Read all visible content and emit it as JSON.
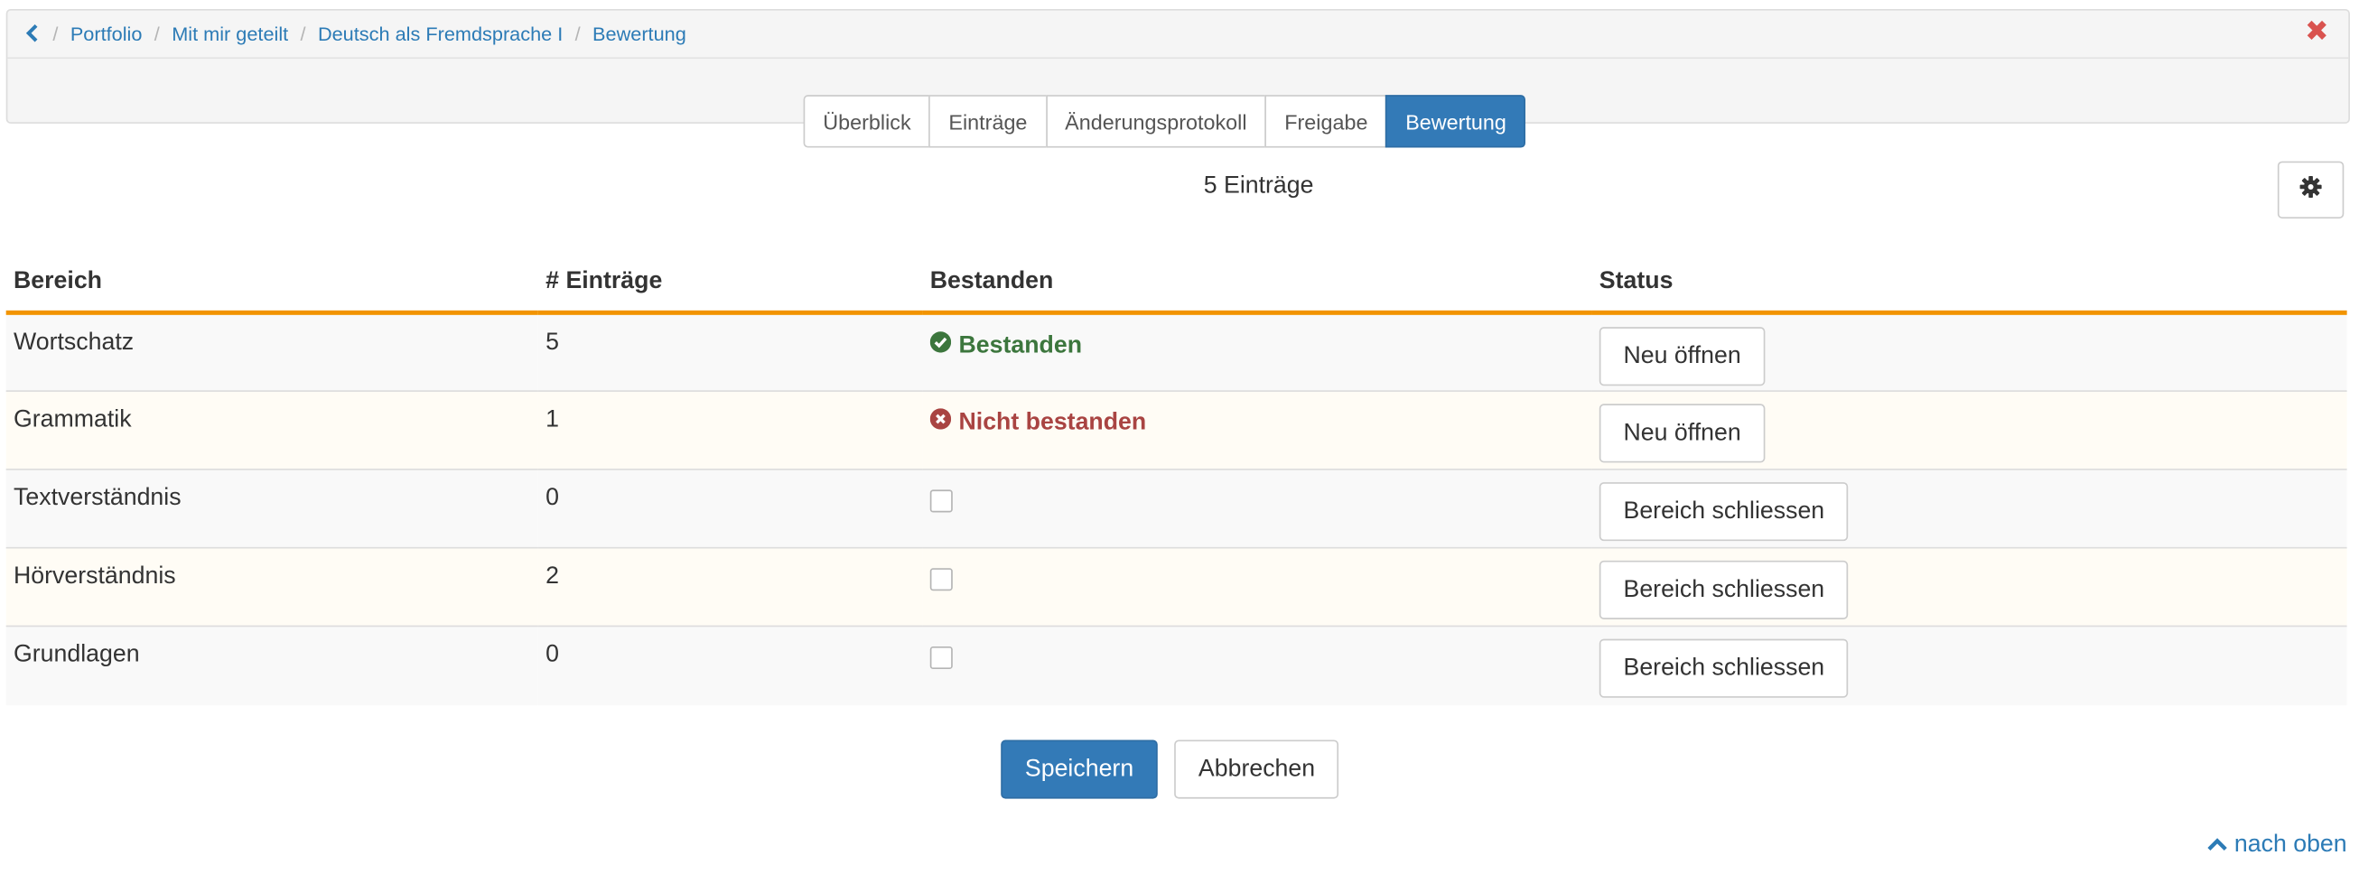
{
  "breadcrumb": {
    "back_icon": "chevron-left-icon",
    "items": [
      "Portfolio",
      "Mit mir geteilt",
      "Deutsch als Fremdsprache I",
      "Bewertung"
    ],
    "close_icon": "close-icon"
  },
  "tabs": [
    {
      "label": "Überblick",
      "active": false
    },
    {
      "label": "Einträge",
      "active": false
    },
    {
      "label": "Änderungsprotokoll",
      "active": false
    },
    {
      "label": "Freigabe",
      "active": false
    },
    {
      "label": "Bewertung",
      "active": true
    }
  ],
  "summary": "5 Einträge",
  "settings_icon": "gear-icon",
  "table": {
    "headers": [
      "Bereich",
      "# Einträge",
      "Bestanden",
      "Status"
    ],
    "rows": [
      {
        "bereich": "Wortschatz",
        "eintraege": "5",
        "bestanden": "Bestanden",
        "bestanden_state": "passed",
        "action": "Neu öffnen"
      },
      {
        "bereich": "Grammatik",
        "eintraege": "1",
        "bestanden": "Nicht bestanden",
        "bestanden_state": "failed",
        "action": "Neu öffnen"
      },
      {
        "bereich": "Textverständnis",
        "eintraege": "0",
        "bestanden": "",
        "bestanden_state": "checkbox",
        "action": "Bereich schliessen"
      },
      {
        "bereich": "Hörverständnis",
        "eintraege": "2",
        "bestanden": "",
        "bestanden_state": "checkbox",
        "action": "Bereich schliessen"
      },
      {
        "bereich": "Grundlagen",
        "eintraege": "0",
        "bestanden": "",
        "bestanden_state": "checkbox",
        "action": "Bereich schliessen"
      }
    ]
  },
  "actions": {
    "save": "Speichern",
    "cancel": "Abbrechen"
  },
  "to_top": "nach oben",
  "colors": {
    "primary": "#337ab7",
    "link": "#2c7bb6",
    "accent_rule": "#f29400",
    "passed": "#3c763d",
    "failed": "#a94442",
    "close": "#d9534f"
  }
}
